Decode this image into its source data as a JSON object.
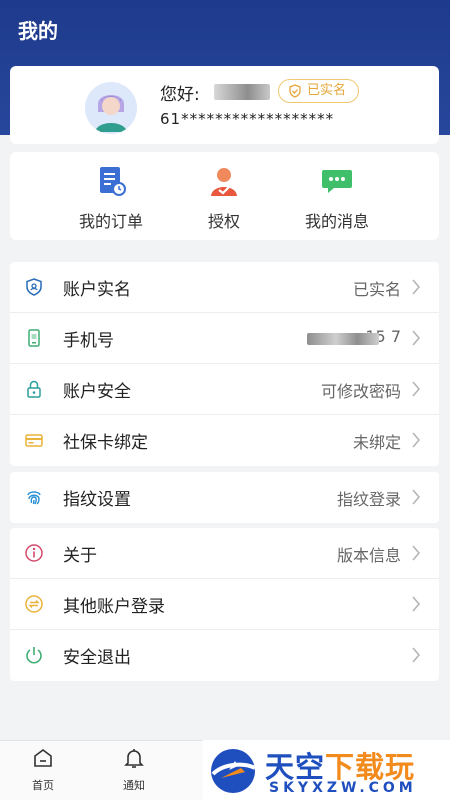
{
  "header": {
    "title": "我的"
  },
  "profile": {
    "greeting": "您好:",
    "name_suffix": "",
    "verified_label": "已实名",
    "id_number": "61******************"
  },
  "quick_actions": [
    {
      "label": "我的订单",
      "icon": "order-document-icon"
    },
    {
      "label": "授权",
      "icon": "authorize-person-icon"
    },
    {
      "label": "我的消息",
      "icon": "message-chat-icon"
    }
  ],
  "group_account": [
    {
      "label": "账户实名",
      "value": "已实名",
      "icon": "id-shield-icon"
    },
    {
      "label": "手机号",
      "value": "15   7",
      "icon": "phone-icon"
    },
    {
      "label": "账户安全",
      "value": "可修改密码",
      "icon": "lock-icon"
    },
    {
      "label": "社保卡绑定",
      "value": "未绑定",
      "icon": "card-icon"
    }
  ],
  "group_fingerprint": [
    {
      "label": "指纹设置",
      "value": "指纹登录",
      "icon": "fingerprint-icon"
    }
  ],
  "group_about": [
    {
      "label": "关于",
      "value": "版本信息",
      "icon": "info-icon"
    },
    {
      "label": "其他账户登录",
      "value": "",
      "icon": "switch-account-icon"
    },
    {
      "label": "安全退出",
      "value": "",
      "icon": "power-icon"
    }
  ],
  "bottom_nav": [
    {
      "label": "首页",
      "icon": "home-icon"
    },
    {
      "label": "通知",
      "icon": "bell-icon"
    }
  ],
  "watermark": {
    "brand_a": "天空",
    "brand_b": "下载玩",
    "domain": "SKYXZW.COM"
  },
  "colors": {
    "header": "#1e3a8c",
    "badge": "#e6a63a",
    "brand": "#1f4fbf",
    "brand_accent": "#f28a1c"
  }
}
